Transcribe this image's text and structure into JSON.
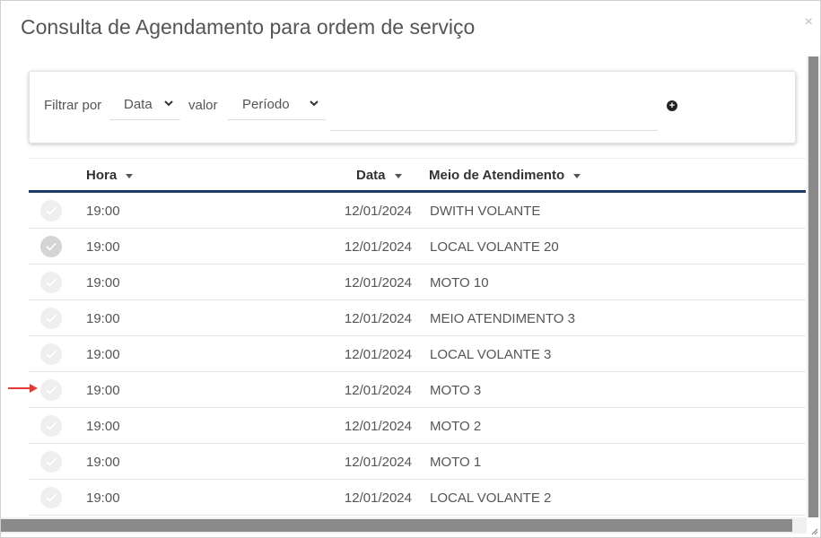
{
  "modal": {
    "title": "Consulta de Agendamento para ordem de serviço",
    "close_label": "×"
  },
  "filter": {
    "filter_label": "Filtrar por",
    "field_select": "Data",
    "value_label": "valor",
    "value_select": "Período",
    "input_value": "",
    "add_icon": "plus-circle-icon"
  },
  "table": {
    "columns": [
      "Hora",
      "Data",
      "Meio de Atendimento"
    ],
    "rows": [
      {
        "hora": "19:00",
        "data": "12/01/2024",
        "meio": "DWITH VOLANTE",
        "checked": false
      },
      {
        "hora": "19:00",
        "data": "12/01/2024",
        "meio": "LOCAL VOLANTE 20",
        "checked": true
      },
      {
        "hora": "19:00",
        "data": "12/01/2024",
        "meio": "MOTO 10",
        "checked": false
      },
      {
        "hora": "19:00",
        "data": "12/01/2024",
        "meio": "MEIO ATENDIMENTO 3",
        "checked": false
      },
      {
        "hora": "19:00",
        "data": "12/01/2024",
        "meio": "LOCAL VOLANTE 3",
        "checked": false
      },
      {
        "hora": "19:00",
        "data": "12/01/2024",
        "meio": "MOTO 3",
        "checked": false
      },
      {
        "hora": "19:00",
        "data": "12/01/2024",
        "meio": "MOTO 2",
        "checked": false
      },
      {
        "hora": "19:00",
        "data": "12/01/2024",
        "meio": "MOTO 1",
        "checked": false
      },
      {
        "hora": "19:00",
        "data": "12/01/2024",
        "meio": "LOCAL VOLANTE 2",
        "checked": false
      }
    ]
  },
  "colors": {
    "header_underline": "#1f3a60",
    "annotation_arrow": "#e53935"
  }
}
